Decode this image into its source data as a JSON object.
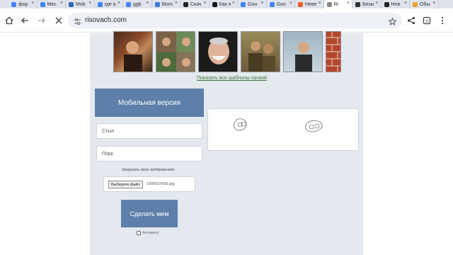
{
  "browser": {
    "tabs": [
      {
        "label": "фор",
        "color": "#4285f4"
      },
      {
        "label": "Мес",
        "color": "#4285f4"
      },
      {
        "label": "Mob",
        "color": "#2a6db5"
      },
      {
        "label": "где а",
        "color": "#4285f4"
      },
      {
        "label": "ggb",
        "color": "#4285f4"
      },
      {
        "label": "Mom",
        "color": "#3b7dd8"
      },
      {
        "label": "Скач",
        "color": "#222222"
      },
      {
        "label": "Как н",
        "color": "#111111"
      },
      {
        "label": "Goo",
        "color": "#4285f4"
      },
      {
        "label": "Goo",
        "color": "#4285f4"
      },
      {
        "label": "Неве",
        "color": "#e8632b"
      },
      {
        "label": "Ri",
        "color": "#888888",
        "active": true
      },
      {
        "label": "Безы",
        "color": "#333333"
      },
      {
        "label": "Нов",
        "color": "#222222"
      },
      {
        "label": "Обы",
        "color": "#f0a030"
      }
    ],
    "url": "risovach.com"
  },
  "page": {
    "show_all_link": "Показать все шаблоны пачкой",
    "mobile_version_button": "Мобильная версия",
    "top_text_placeholder": "Стыл",
    "bottom_text_placeholder": "Порк",
    "upload_label": "Загрузить свое изображение:",
    "choose_file_button": "Выберите файл",
    "file_name": "1000027690.jpg",
    "make_meme_button": "Сделать мем",
    "anonymous_label": "Анонимно"
  },
  "colors": {
    "accent": "#5e7fa9",
    "column_bg": "#e4e8ef",
    "link": "#3a7a3a"
  }
}
